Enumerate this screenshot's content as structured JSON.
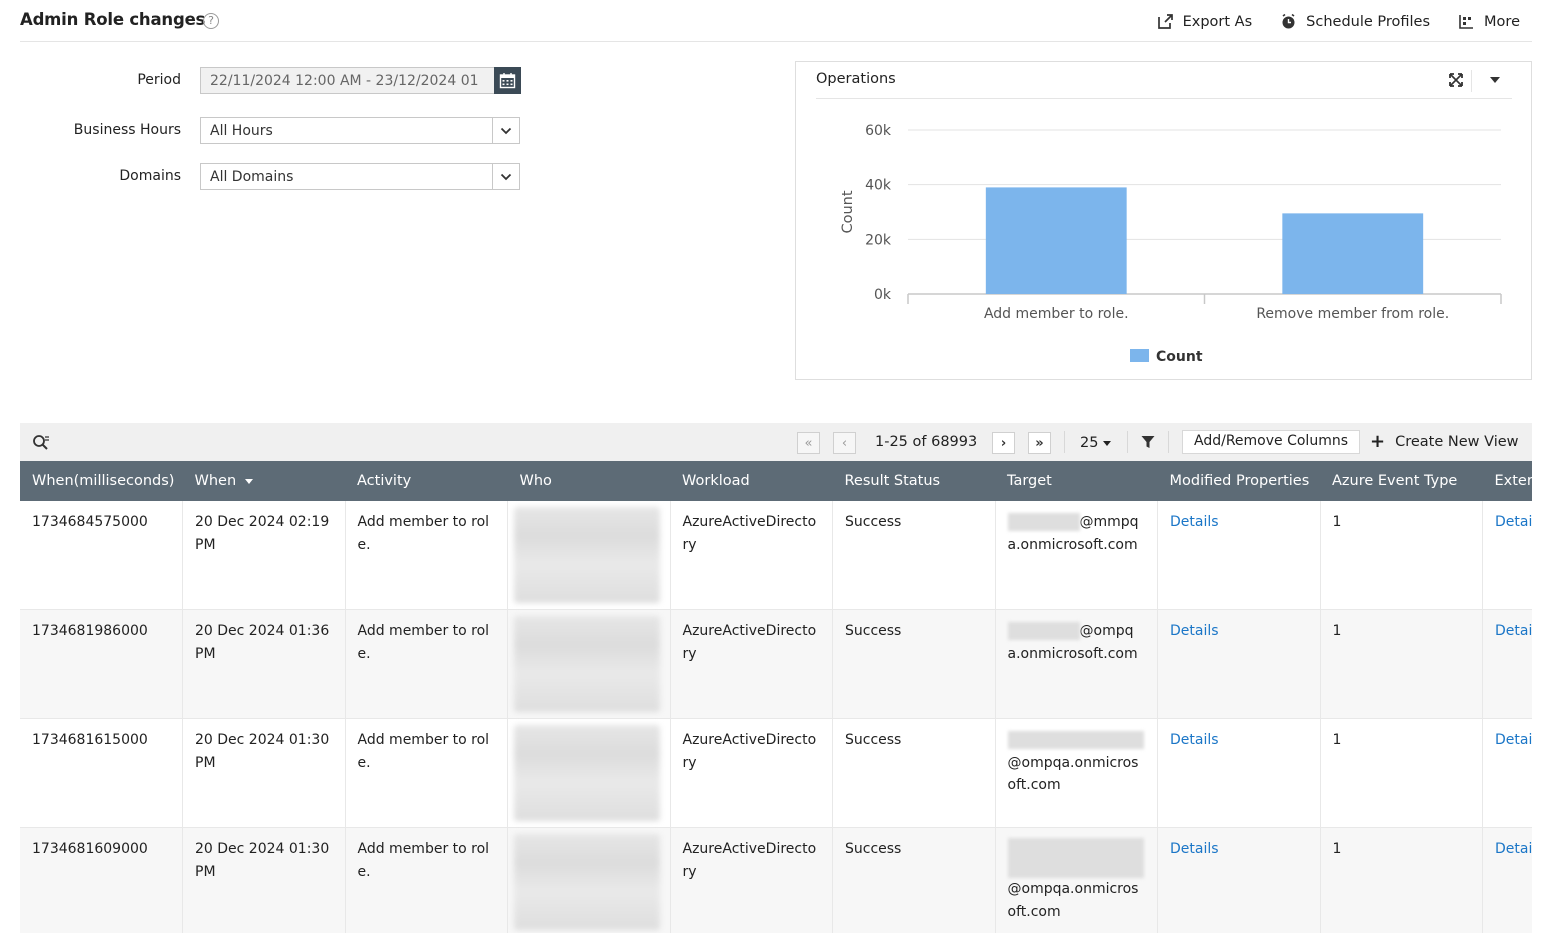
{
  "header": {
    "title": "Admin Role changes",
    "help": "?",
    "actions": [
      {
        "label": "Export As",
        "icon": "export-icon"
      },
      {
        "label": "Schedule Profiles",
        "icon": "clock-icon"
      },
      {
        "label": "More",
        "icon": "more-icon"
      }
    ]
  },
  "filters": {
    "period_label": "Period",
    "period_value": "22/11/2024 12:00 AM - 23/12/2024 01",
    "business_hours_label": "Business Hours",
    "business_hours_value": "All Hours",
    "domains_label": "Domains",
    "domains_value": "All Domains"
  },
  "chart_panel": {
    "title": "Operations"
  },
  "chart_data": {
    "type": "bar",
    "categories": [
      "Add member to role.",
      "Remove member from role."
    ],
    "series": [
      {
        "name": "Count",
        "values": [
          39000,
          29500
        ],
        "color": "#7cb5ec"
      }
    ],
    "ylabel": "Count",
    "xlabel": "",
    "ylim": [
      0,
      60000
    ],
    "yticks": [
      0,
      20000,
      40000,
      60000
    ],
    "ytick_labels": [
      "0k",
      "20k",
      "40k",
      "60k"
    ],
    "legend": "bottom-center",
    "grid": true
  },
  "toolbar": {
    "page_info": "1-25 of 68993",
    "page_size": "25",
    "add_remove_columns": "Add/Remove Columns",
    "create_new_view": "Create New View"
  },
  "table": {
    "columns": [
      "When(milliseconds)",
      "When",
      "Activity",
      "Who",
      "Workload",
      "Result Status",
      "Target",
      "Modified Properties",
      "Azure Event Type",
      "Exter"
    ],
    "rows": [
      {
        "ms": "1734684575000",
        "when": "20 Dec 2024 02:19 PM",
        "activity": "Add member to role.",
        "workload": "AzureActiveDirectory",
        "result": "Success",
        "target_suffix": "@mmpqa.onmicrosoft.com",
        "modified": "Details",
        "event_type": "1",
        "ext": "Details"
      },
      {
        "ms": "1734681986000",
        "when": "20 Dec 2024 01:36 PM",
        "activity": "Add member to role.",
        "workload": "AzureActiveDirectory",
        "result": "Success",
        "target_suffix": "@ompqa.onmicrosoft.com",
        "modified": "Details",
        "event_type": "1",
        "ext": "Details"
      },
      {
        "ms": "1734681615000",
        "when": "20 Dec 2024 01:30 PM",
        "activity": "Add member to role.",
        "workload": "AzureActiveDirectory",
        "result": "Success",
        "target_suffix": "@ompqa.onmicrosoft.com",
        "modified": "Details",
        "event_type": "1",
        "ext": "Details"
      },
      {
        "ms": "1734681609000",
        "when": "20 Dec 2024 01:30 PM",
        "activity": "Add member to role.",
        "workload": "AzureActiveDirectory",
        "result": "Success",
        "target_suffix": "@ompqa.onmicrosoft.com",
        "modified": "Details",
        "event_type": "1",
        "ext": "Details"
      }
    ]
  }
}
